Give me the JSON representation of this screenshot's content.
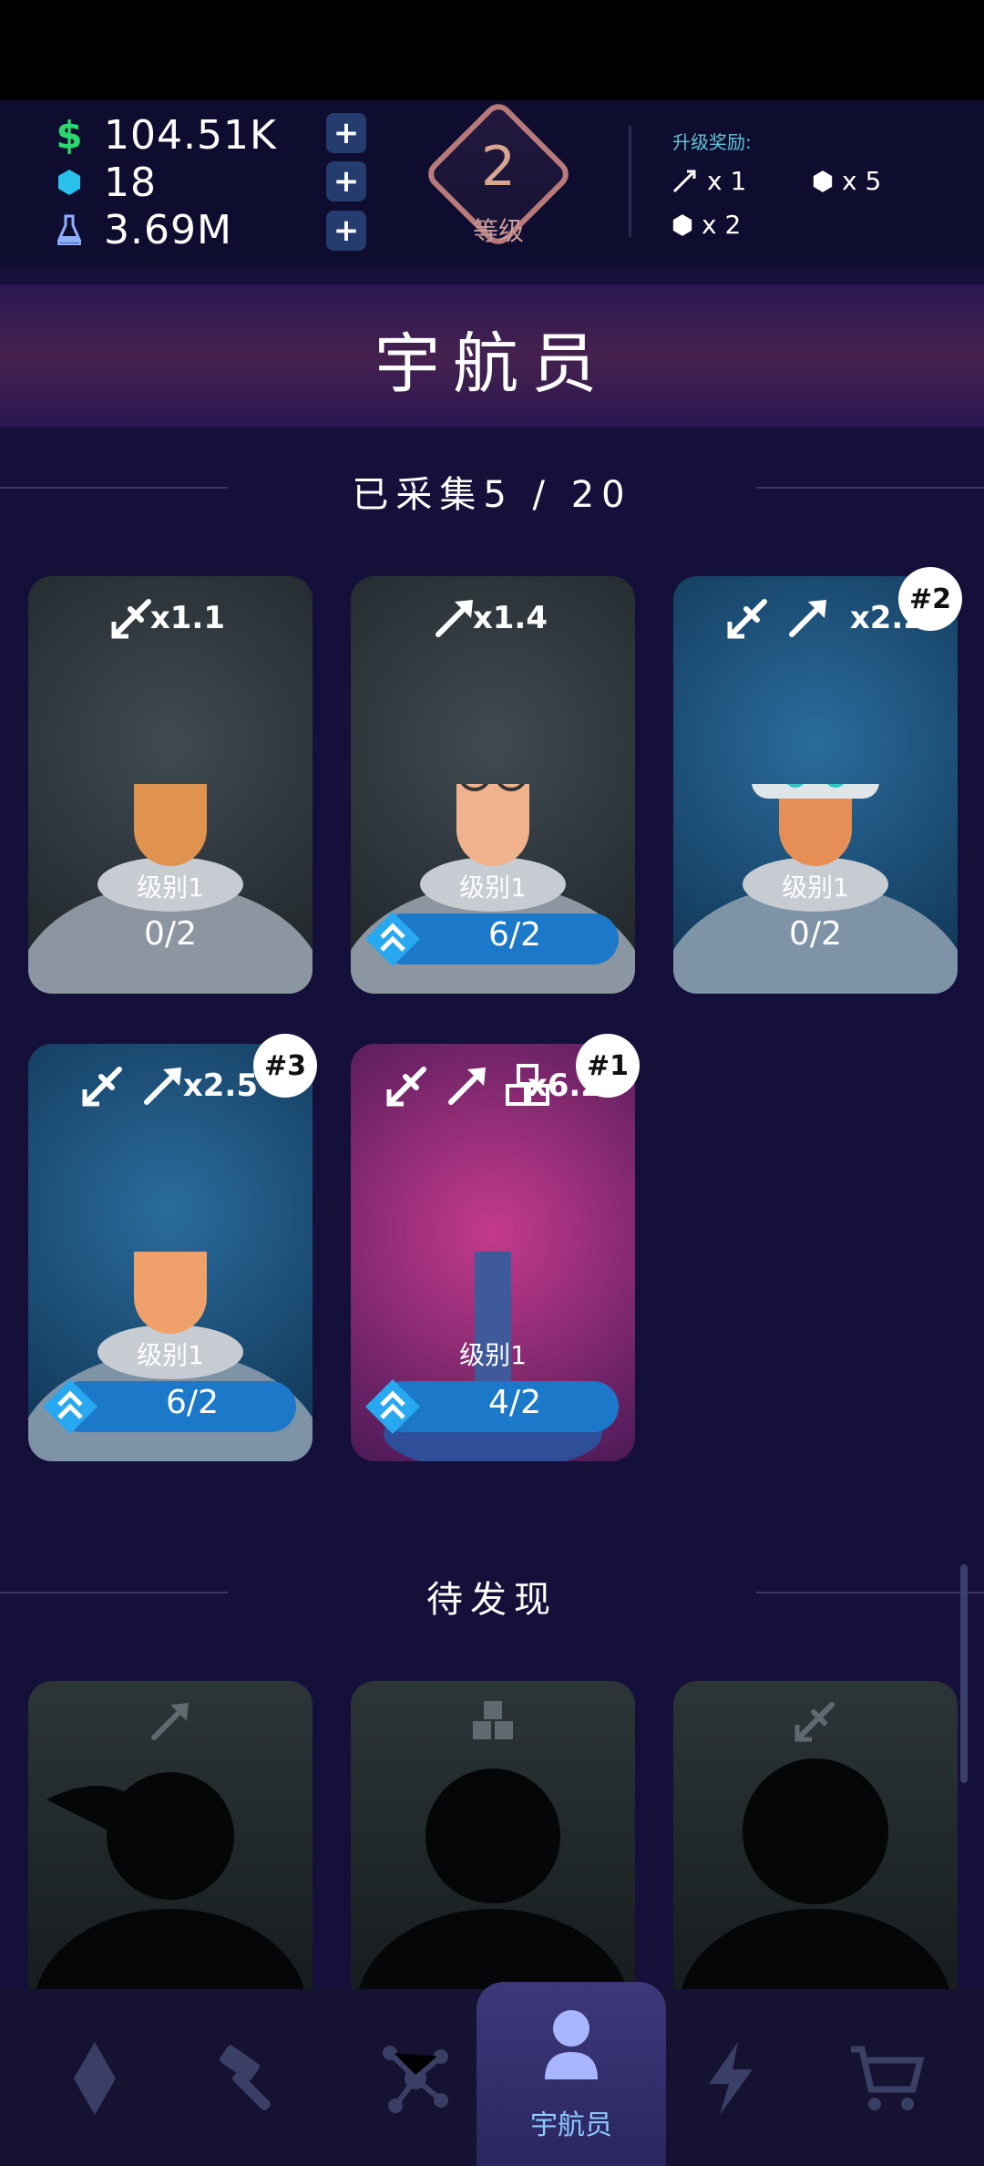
{
  "header": {
    "money": "104.51K",
    "gems": "18",
    "research": "3.69M",
    "level": "2",
    "level_label": "等级",
    "reward_title": "升级奖励:",
    "reward_rocket": "x 1",
    "reward_gem_a": "x 5",
    "reward_gem_b": "x 2"
  },
  "page_title": "宇航员",
  "collected_label": "已采集5 / 20",
  "undiscovered_label": "待发现",
  "cards": [
    {
      "multiplier": "x1.1",
      "level": "级别1",
      "progress": "0/2",
      "rank": ""
    },
    {
      "multiplier": "x1.4",
      "level": "级别1",
      "progress": "6/2",
      "rank": ""
    },
    {
      "multiplier": "x2.2",
      "level": "级别1",
      "progress": "0/2",
      "rank": "#2"
    },
    {
      "multiplier": "x2.5",
      "level": "级别1",
      "progress": "6/2",
      "rank": "#3"
    },
    {
      "multiplier": "x6.2",
      "level": "级别1",
      "progress": "4/2",
      "rank": "#1"
    }
  ],
  "nav": {
    "active_label": "宇航员",
    "items": [
      "diamond-icon",
      "hammer-icon",
      "network-icon",
      "astronaut-icon",
      "lightning-icon",
      "cart-icon"
    ]
  },
  "colors": {
    "background": "#14103a",
    "accent_blue": "#1c78c9",
    "money_green": "#2bd86d",
    "gem_cyan": "#27c1ea",
    "level_rose": "#c89a9a"
  }
}
